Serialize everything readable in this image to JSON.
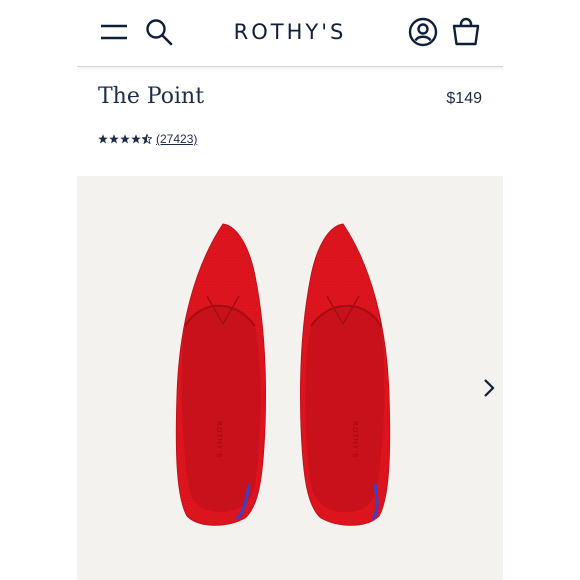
{
  "header": {
    "brand": "ROTHY'S",
    "icons": [
      "menu-icon",
      "search-icon",
      "account-icon",
      "bag-icon"
    ]
  },
  "product": {
    "title": "The Point",
    "price": "$149",
    "rating": 4.5,
    "review_count": "(27423)",
    "insole_brand": "ROTHY'S"
  },
  "colors": {
    "brand_navy": "#0f1f3a",
    "shoe_red": "#d6141c",
    "heel_stripe": "#3b3fc9",
    "image_bg": "#f4f2ef"
  },
  "gallery": {
    "next_icon": "chevron-right-icon"
  }
}
